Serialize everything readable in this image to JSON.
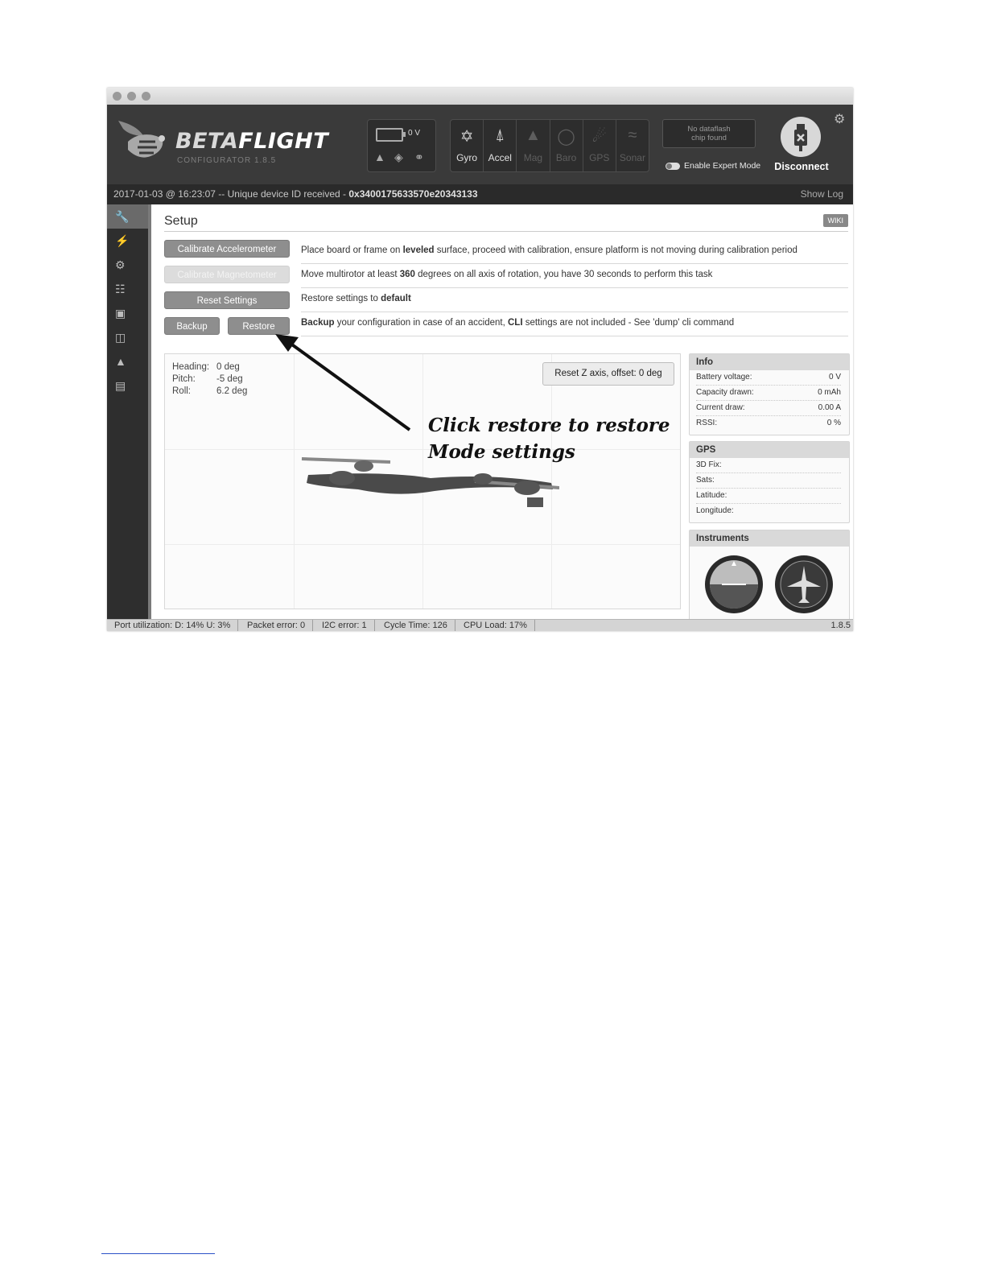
{
  "app": {
    "name_prefix": "BETA",
    "name_suffix": "FLIGHT",
    "subtitle": "CONFIGURATOR  1.8.5"
  },
  "header": {
    "battery_voltage": "0 V",
    "sensors": [
      {
        "label": "Gyro",
        "icon": "gyro-icon",
        "active": true
      },
      {
        "label": "Accel",
        "icon": "accel-icon",
        "active": true
      },
      {
        "label": "Mag",
        "icon": "mag-icon",
        "active": false
      },
      {
        "label": "Baro",
        "icon": "baro-icon",
        "active": false
      },
      {
        "label": "GPS",
        "icon": "gps-icon",
        "active": false
      },
      {
        "label": "Sonar",
        "icon": "sonar-icon",
        "active": false
      }
    ],
    "dataflash_line1": "No dataflash",
    "dataflash_line2": "chip found",
    "expert_mode_label": "Enable Expert Mode",
    "disconnect_label": "Disconnect"
  },
  "log": {
    "prefix": "2017-01-03 @ 16:23:07 -- Unique device ID received - ",
    "device_id": "0x3400175633570e20343133",
    "show_log": "Show Log"
  },
  "page": {
    "title": "Setup",
    "wiki_label": "WIKI"
  },
  "setup_rows": [
    {
      "button": "Calibrate Accelerometer",
      "parts": [
        "Place board or frame on ",
        "leveled",
        " surface, proceed with calibration, ensure platform is not moving during calibration period"
      ]
    },
    {
      "button": "Calibrate Magnetometer",
      "parts": [
        "Move multirotor at least ",
        "360",
        " degrees on all axis of rotation, you have 30 seconds to perform this task"
      ]
    },
    {
      "button": "Reset Settings",
      "parts": [
        "Restore settings to ",
        "default",
        ""
      ]
    },
    {
      "button_backup": "Backup",
      "button_restore": "Restore",
      "parts": [
        "",
        "Backup",
        " your configuration in case of an accident, ",
        "CLI",
        " settings are not included - See 'dump' cli command"
      ]
    }
  ],
  "attitude": {
    "heading_label": "Heading:",
    "heading_value": "0 deg",
    "pitch_label": "Pitch:",
    "pitch_value": "-5 deg",
    "roll_label": "Roll:",
    "roll_value": "6.2 deg"
  },
  "reset_z_label": "Reset Z axis, offset: 0 deg",
  "callout": {
    "line1": "Click restore to restore",
    "line2": "Mode settings"
  },
  "info_panel": {
    "title": "Info",
    "rows": [
      {
        "label": "Battery voltage:",
        "value": "0 V"
      },
      {
        "label": "Capacity drawn:",
        "value": "0 mAh"
      },
      {
        "label": "Current draw:",
        "value": "0.00 A"
      },
      {
        "label": "RSSI:",
        "value": "0 %"
      }
    ]
  },
  "gps_panel": {
    "title": "GPS",
    "rows": [
      {
        "label": "3D Fix:",
        "value": ""
      },
      {
        "label": "Sats:",
        "value": ""
      },
      {
        "label": "Latitude:",
        "value": ""
      },
      {
        "label": "Longitude:",
        "value": ""
      }
    ]
  },
  "instruments_panel": {
    "title": "Instruments"
  },
  "status_bar": {
    "port_util": "Port utilization: D: 14% U: 3%",
    "packet_error": "Packet error: 0",
    "i2c_error": "I2C error: 1",
    "cycle_time": "Cycle Time: 126",
    "cpu_load": "CPU Load: 17%",
    "version": "1.8.5"
  }
}
